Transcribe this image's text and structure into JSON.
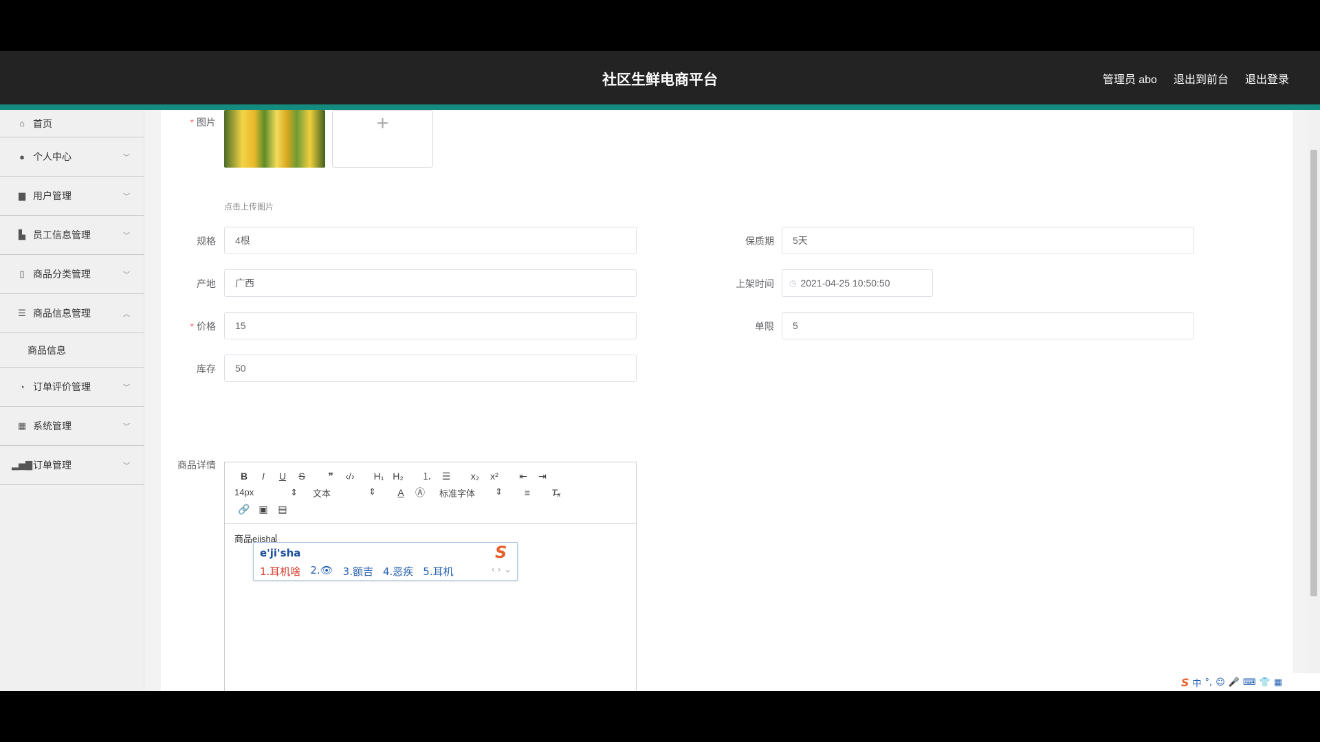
{
  "header": {
    "title": "社区生鲜电商平台",
    "admin": "管理员 abo",
    "exit_front": "退出到前台",
    "logout": "退出登录"
  },
  "sidebar": {
    "items": [
      {
        "label": "首页",
        "icon": "home-icon"
      },
      {
        "label": "个人中心",
        "icon": "user-icon"
      },
      {
        "label": "用户管理",
        "icon": "users-icon"
      },
      {
        "label": "员工信息管理",
        "icon": "briefcase-icon"
      },
      {
        "label": "商品分类管理",
        "icon": "category-icon"
      },
      {
        "label": "商品信息管理",
        "icon": "list-icon"
      },
      {
        "label": "订单评价管理",
        "icon": "rating-icon"
      },
      {
        "label": "系统管理",
        "icon": "grid-icon"
      },
      {
        "label": "订单管理",
        "icon": "bar-chart-icon"
      }
    ],
    "subitem": "商品信息"
  },
  "form": {
    "image_label": "图片",
    "upload_hint": "点击上传图片",
    "spec_label": "规格",
    "spec_value": "4根",
    "shelf_label": "保质期",
    "shelf_value": "5天",
    "origin_label": "产地",
    "origin_value": "广西",
    "time_label": "上架时间",
    "time_value": "2021-04-25 10:50:50",
    "price_label": "价格",
    "price_value": "15",
    "limit_label": "单限",
    "limit_value": "5",
    "stock_label": "库存",
    "stock_value": "50",
    "detail_label": "商品详情"
  },
  "editor": {
    "font_size": "14px",
    "block_type": "文本",
    "font_family": "标准字体",
    "content": "商品ejisha"
  },
  "ime": {
    "pinyin": "e'ji'sha",
    "candidates": [
      "1.耳机啥",
      "2.👁",
      "3.额吉",
      "4.恶疾",
      "5.耳机"
    ]
  },
  "colors": {
    "header_bg": "#232323",
    "accent": "#138b7e"
  }
}
